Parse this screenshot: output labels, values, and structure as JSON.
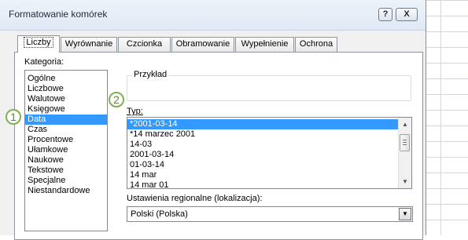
{
  "window": {
    "title": "Formatowanie komórek",
    "help_label": "?",
    "close_label": "X"
  },
  "tabs": [
    "Liczby",
    "Wyrównanie",
    "Czcionka",
    "Obramowanie",
    "Wypełnienie",
    "Ochrona"
  ],
  "category": {
    "label": "Kategoria:",
    "items": [
      "Ogólne",
      "Liczbowe",
      "Walutowe",
      "Księgowe",
      "Data",
      "Czas",
      "Procentowe",
      "Ułamkowe",
      "Naukowe",
      "Tekstowe",
      "Specjalne",
      "Niestandardowe"
    ],
    "selected": "Data"
  },
  "sample": {
    "label": "Przykład"
  },
  "type": {
    "label": "Typ:",
    "items": [
      "*2001-03-14",
      "*14 marzec 2001",
      "14-03",
      "2001-03-14",
      "01-03-14",
      "14 mar",
      "14 mar 01"
    ],
    "selected": "*2001-03-14"
  },
  "locale": {
    "label": "Ustawienia regionalne (lokalizacja):",
    "value": "Polski (Polska)"
  },
  "callouts": [
    "1",
    "2"
  ],
  "colors": {
    "selection": "#3399ff",
    "callout": "#7fb24a"
  }
}
